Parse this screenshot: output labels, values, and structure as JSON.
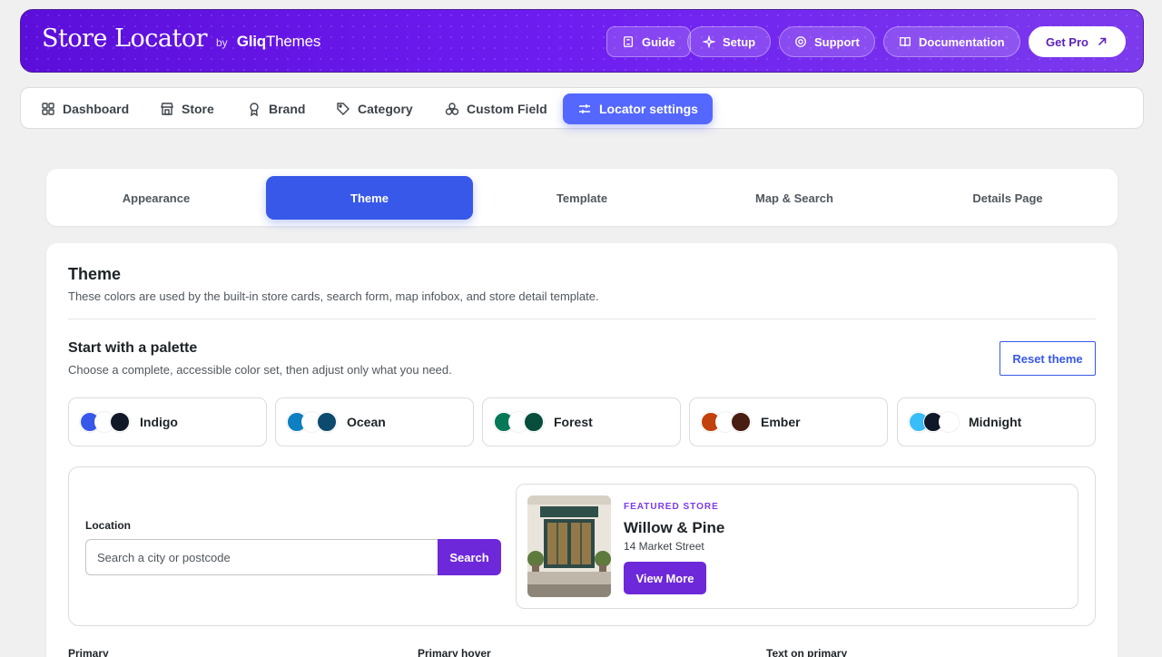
{
  "header": {
    "brand_title": "Store Locator",
    "brand_by": "by",
    "brand_company_bold": "Gliq",
    "brand_company_rest": "Themes",
    "buttons": [
      {
        "label": "Guide",
        "icon": "book-icon"
      },
      {
        "label": "Setup",
        "icon": "sparkle-icon"
      },
      {
        "label": "Support",
        "icon": "lifebuoy-icon"
      },
      {
        "label": "Documentation",
        "icon": "open-book-icon"
      },
      {
        "label": "Get Pro",
        "icon": "arrow-up-right-icon"
      }
    ]
  },
  "nav": {
    "items": [
      {
        "label": "Dashboard",
        "icon": "grid-icon"
      },
      {
        "label": "Store",
        "icon": "storefront-icon"
      },
      {
        "label": "Brand",
        "icon": "award-icon"
      },
      {
        "label": "Category",
        "icon": "tags-icon"
      },
      {
        "label": "Custom Field",
        "icon": "boxes-icon"
      },
      {
        "label": "Locator settings",
        "icon": "sliders-icon",
        "active": true
      }
    ]
  },
  "tabs": [
    {
      "label": "Appearance"
    },
    {
      "label": "Theme",
      "active": true
    },
    {
      "label": "Template"
    },
    {
      "label": "Map & Search"
    },
    {
      "label": "Details Page"
    }
  ],
  "theme": {
    "title": "Theme",
    "description": "These colors are used by the built-in store cards, search form, map infobox, and store detail template.",
    "palette_title": "Start with a palette",
    "palette_subtitle": "Choose a complete, accessible color set, then adjust only what you need.",
    "reset_label": "Reset theme",
    "palettes": [
      {
        "name": "Indigo",
        "colors": [
          "#3858e9",
          "#ffffff",
          "#111827"
        ]
      },
      {
        "name": "Ocean",
        "colors": [
          "#0e7fc0",
          "#ffffff",
          "#0c4a6e"
        ]
      },
      {
        "name": "Forest",
        "colors": [
          "#047857",
          "#ffffff",
          "#064e3b"
        ]
      },
      {
        "name": "Ember",
        "colors": [
          "#c2410c",
          "#ffffff",
          "#4a1d12"
        ]
      },
      {
        "name": "Midnight",
        "colors": [
          "#38bdf8",
          "#0f172a",
          "#ffffff"
        ]
      }
    ]
  },
  "preview": {
    "location_label": "Location",
    "search_placeholder": "Search a city or postcode",
    "search_button": "Search",
    "featured_label": "FEATURED STORE",
    "store_name": "Willow & Pine",
    "store_address": "14 Market Street",
    "view_more": "View More"
  },
  "fields": [
    {
      "label": "Primary"
    },
    {
      "label": "Primary hover"
    },
    {
      "label": "Text on primary"
    }
  ],
  "colors": {
    "header_gradient_start": "#5b0ed9",
    "header_gradient_end": "#7c3aed",
    "nav_active": "#5468ff",
    "tab_active": "#3858e9",
    "preview_primary": "#6d28d9"
  }
}
